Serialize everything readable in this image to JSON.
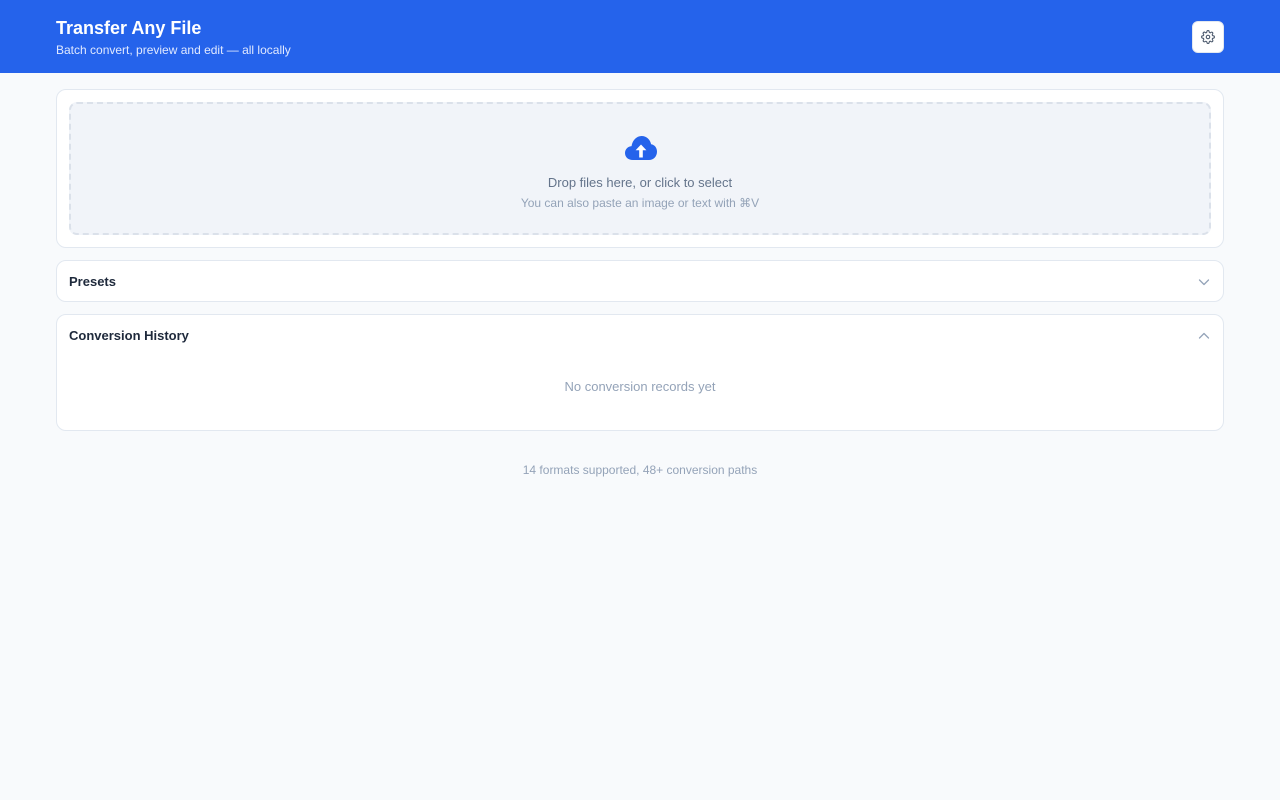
{
  "header": {
    "title": "Transfer Any File",
    "subtitle": "Batch convert, preview and edit — all locally",
    "settings_icon": "gear-icon",
    "background_color": "#2563eb"
  },
  "upload": {
    "icon": "cloud-upload-icon",
    "primary_text": "Drop files here, or click to select",
    "secondary_text": "You can also paste an image or text with ⌘V"
  },
  "presets": {
    "title": "Presets",
    "expanded": false,
    "icon": "chevron-down-icon"
  },
  "history": {
    "title": "Conversion History",
    "expanded": true,
    "icon": "chevron-up-icon",
    "empty_text": "No conversion records yet"
  },
  "footer": {
    "text": "14 formats supported, 48+ conversion paths"
  }
}
